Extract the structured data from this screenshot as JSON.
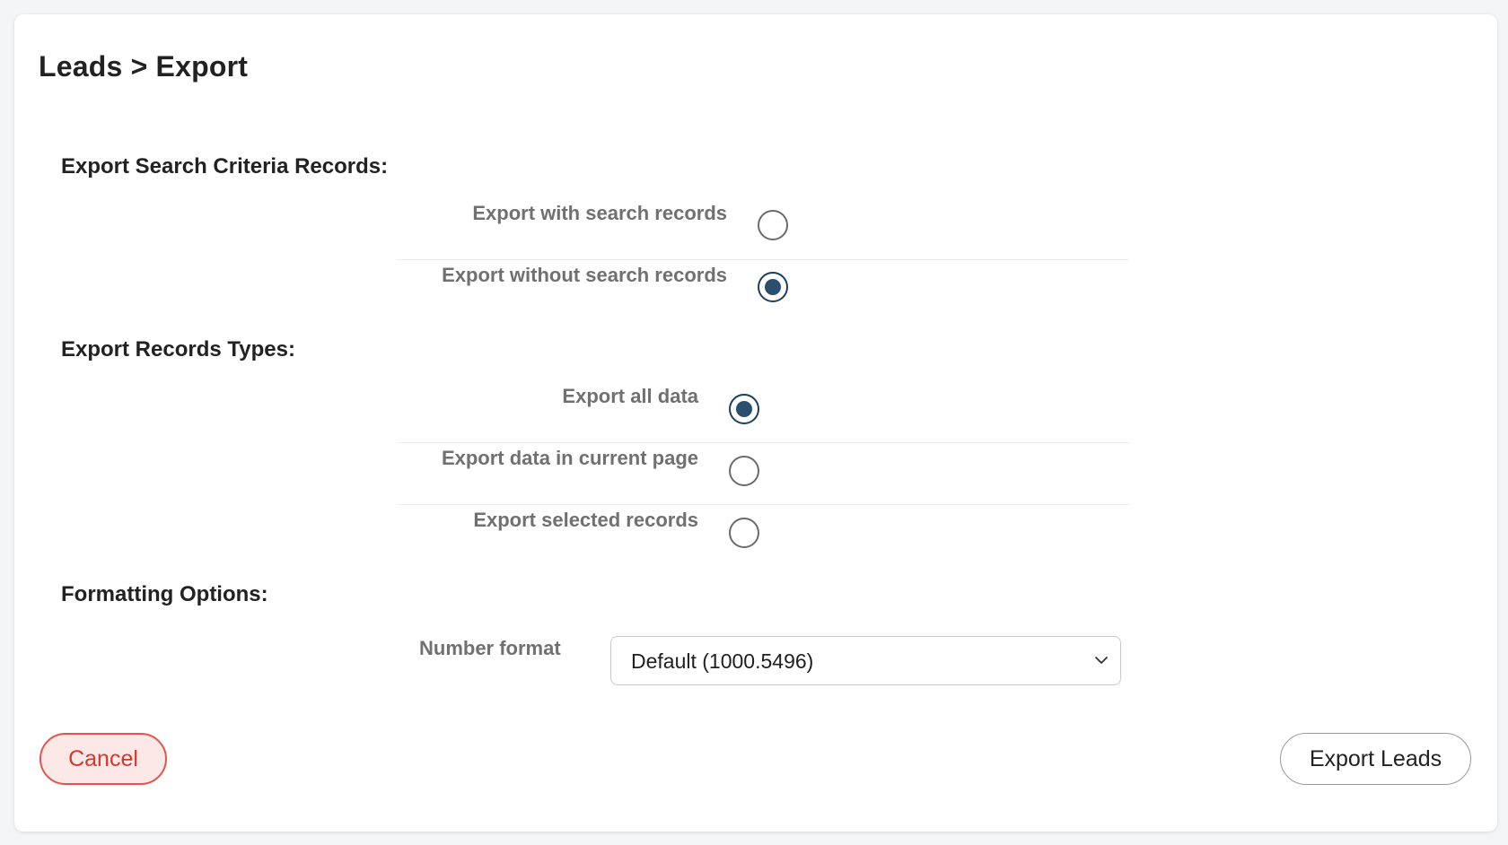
{
  "breadcrumb": "Leads > Export",
  "sections": {
    "search_criteria": {
      "title": "Export Search Criteria Records:",
      "options": [
        {
          "label": "Export with search records",
          "checked": false
        },
        {
          "label": "Export without search records",
          "checked": true
        }
      ]
    },
    "record_types": {
      "title": "Export Records Types:",
      "options": [
        {
          "label": "Export all data",
          "checked": true
        },
        {
          "label": "Export data in current page",
          "checked": false
        },
        {
          "label": "Export selected records",
          "checked": false
        }
      ]
    },
    "formatting": {
      "title": "Formatting Options:",
      "number_format_label": "Number format",
      "number_format_value": "Default (1000.5496)"
    }
  },
  "buttons": {
    "cancel": "Cancel",
    "export": "Export Leads"
  },
  "colors": {
    "radio_checked": "#2a4f6e",
    "cancel_border": "#e5544b",
    "cancel_bg": "#fde8e8"
  }
}
